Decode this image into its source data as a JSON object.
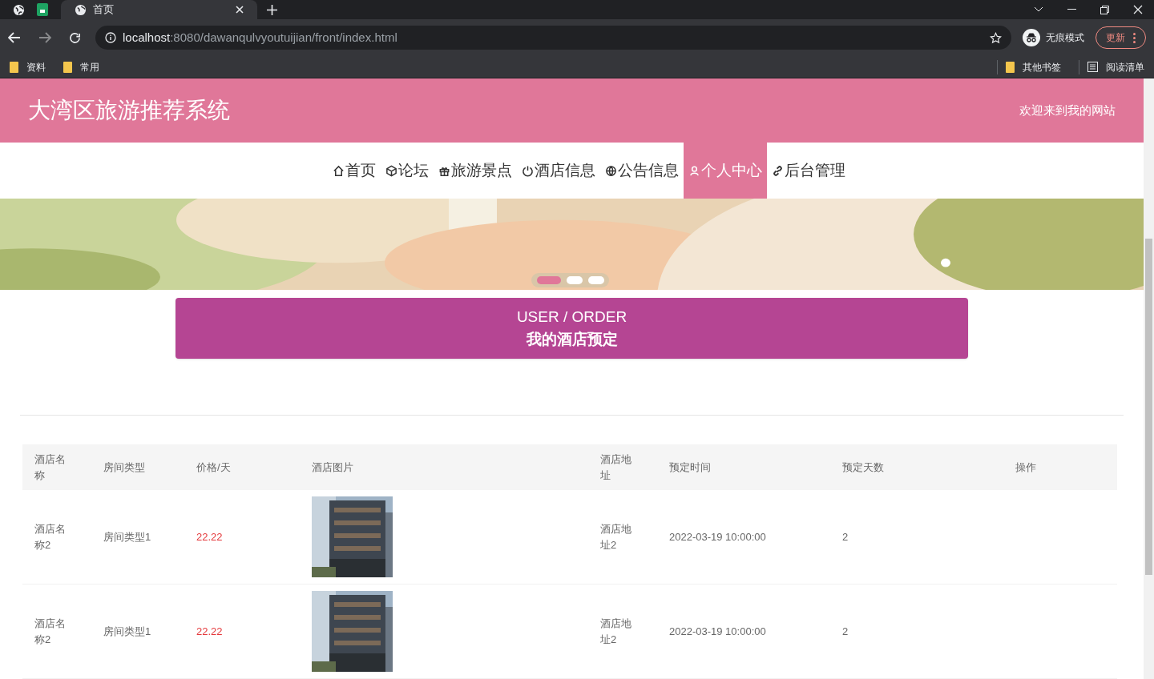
{
  "browser": {
    "tabs": [
      {
        "title": "首页",
        "selected": true
      }
    ],
    "url_host": "localhost",
    "url_rest": ":8080/dawanqulvyoutuijian/front/index.html",
    "incognito": "无痕模式",
    "update": "更新",
    "bookmarks": [
      "资料",
      "常用"
    ],
    "bookmarks_right": [
      {
        "kind": "folder",
        "label": "其他书签"
      },
      {
        "kind": "list",
        "label": "阅读清单"
      }
    ]
  },
  "header": {
    "title": "大湾区旅游推荐系统",
    "welcome": "欢迎来到我的网站"
  },
  "nav": [
    {
      "kind": "home",
      "label": "首页",
      "selected": false
    },
    {
      "kind": "cube",
      "label": "论坛",
      "selected": false
    },
    {
      "kind": "gift",
      "label": "旅游景点",
      "selected": false
    },
    {
      "kind": "power",
      "label": "酒店信息",
      "selected": false
    },
    {
      "kind": "globe",
      "label": "公告信息",
      "selected": false
    },
    {
      "kind": "user",
      "label": "个人中心",
      "selected": true
    },
    {
      "kind": "link",
      "label": "后台管理",
      "selected": false
    }
  ],
  "banner": {
    "dots": [
      {
        "selected": true
      },
      {
        "selected": false
      },
      {
        "selected": false
      }
    ]
  },
  "section": {
    "title_en": "USER / ORDER",
    "title_cn": "我的酒店预定"
  },
  "table": {
    "columns": [
      "酒店名称",
      "房间类型",
      "价格/天",
      "酒店图片",
      "酒店地址",
      "预定时间",
      "预定天数",
      "操作"
    ],
    "rows": [
      {
        "name": "酒店名称2",
        "room": "房间类型1",
        "price": "22.22",
        "address": "酒店地址2",
        "time": "2022-03-19 10:00:00",
        "days": "2"
      },
      {
        "name": "酒店名称2",
        "room": "房间类型1",
        "price": "22.22",
        "address": "酒店地址2",
        "time": "2022-03-19 10:00:00",
        "days": "2"
      }
    ]
  }
}
